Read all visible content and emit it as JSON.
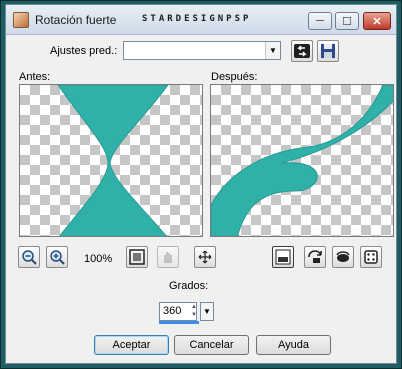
{
  "window": {
    "title": "Rotación fuerte",
    "watermark": "STARDESIGNPSP"
  },
  "controls": {
    "minimize": "─",
    "maximize": "☐",
    "close": "✕"
  },
  "presets": {
    "label": "Ajustes pred.:",
    "value": ""
  },
  "preview": {
    "before_label": "Antes:",
    "after_label": "Después:",
    "accent": "#2fb0a8"
  },
  "zoom": {
    "level": "100%"
  },
  "degrees": {
    "label": "Grados:",
    "value": "360"
  },
  "buttons": {
    "ok": "Aceptar",
    "cancel": "Cancelar",
    "help": "Ayuda"
  },
  "icons": [
    "zoom-out-icon",
    "zoom-in-icon",
    "fit-icon",
    "hand-icon",
    "move-icon",
    "layer-preview-icon",
    "reset-icon",
    "randomize-icon",
    "dice-icon",
    "load-icon",
    "save-icon"
  ]
}
